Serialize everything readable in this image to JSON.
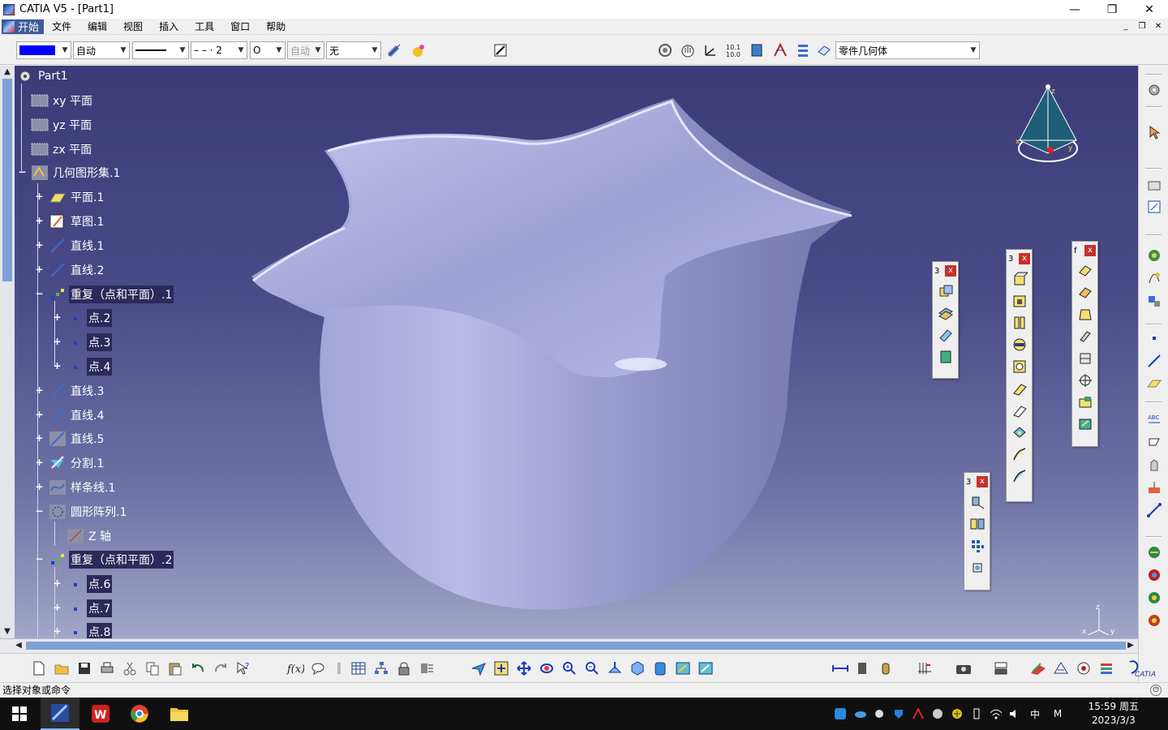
{
  "window": {
    "title": "CATIA V5 - [Part1]",
    "minimize": "—",
    "restore": "❐",
    "close": "✕"
  },
  "menu": {
    "start": "开始",
    "items": [
      "文件",
      "编辑",
      "视图",
      "插入",
      "工具",
      "窗口",
      "帮助"
    ],
    "mdi": [
      "_",
      "❐",
      "✕"
    ]
  },
  "props": {
    "color": "#0000ff",
    "transparency": "自动",
    "linetype": "————",
    "linestyle": "– – · 2",
    "point_symbol": "O",
    "layer_auto": "自动",
    "layer": "无",
    "body_select": "零件几何体"
  },
  "tree": {
    "root": "Part1",
    "nodes": [
      {
        "label": "xy 平面",
        "icon": "plane-icon"
      },
      {
        "label": "yz 平面",
        "icon": "plane-icon"
      },
      {
        "label": "zx 平面",
        "icon": "plane-icon"
      },
      {
        "label": "几何图形集.1",
        "icon": "geometrical-set-icon"
      },
      {
        "label": "平面.1",
        "icon": "plane-feature-icon"
      },
      {
        "label": "草图.1",
        "icon": "sketch-icon"
      },
      {
        "label": "直线.1",
        "icon": "line-icon"
      },
      {
        "label": "直线.2",
        "icon": "line-icon"
      },
      {
        "label": "重复（点和平面）.1",
        "icon": "repetition-icon"
      },
      {
        "label": "点.2",
        "icon": "point-icon"
      },
      {
        "label": "点.3",
        "icon": "point-icon"
      },
      {
        "label": "点.4",
        "icon": "point-icon"
      },
      {
        "label": "直线.3",
        "icon": "line-icon"
      },
      {
        "label": "直线.4",
        "icon": "line-icon"
      },
      {
        "label": "直线.5",
        "icon": "line-icon"
      },
      {
        "label": "分割.1",
        "icon": "split-icon"
      },
      {
        "label": "样条线.1",
        "icon": "spline-icon"
      },
      {
        "label": "圆形阵列.1",
        "icon": "circular-pattern-icon"
      },
      {
        "label": "Z 轴",
        "icon": "axis-icon"
      },
      {
        "label": "重复（点和平面）.2",
        "icon": "repetition-icon"
      },
      {
        "label": "点.6",
        "icon": "point-icon"
      },
      {
        "label": "点.7",
        "icon": "point-icon"
      },
      {
        "label": "点.8",
        "icon": "point-icon"
      }
    ]
  },
  "compass": {
    "x": "x",
    "y": "y",
    "z": "z"
  },
  "mini_axis": {
    "x": "x",
    "y": "y",
    "z": "z"
  },
  "floating_toolbars": [
    {
      "title": "3",
      "close": "x",
      "buttons": [
        "surface-extrude-icon",
        "surface-offset-icon",
        "surface-sweep-icon",
        "surface-fill-icon"
      ]
    },
    {
      "title": "3",
      "close": "x",
      "buttons": [
        "pad-icon",
        "pocket-icon",
        "shaft-icon",
        "groove-icon",
        "hole-icon",
        "rib-icon",
        "slot-icon",
        "stiffener-icon",
        "loft-icon",
        "remove-loft-icon"
      ]
    },
    {
      "title": "f",
      "close": "x",
      "buttons": [
        "fillet-icon",
        "chamfer-icon",
        "draft-icon",
        "shell-icon",
        "thickness-icon",
        "thread-icon",
        "remove-face-icon",
        "replace-face-icon"
      ]
    },
    {
      "title": "3",
      "close": "x",
      "buttons": [
        "translate-icon",
        "mirror-icon",
        "rect-pattern-icon",
        "scale-icon"
      ]
    }
  ],
  "statusbar": {
    "prompt": "选择对象或命令"
  },
  "taskbar": {
    "ime": "中",
    "ime2": "M",
    "time": "15:59 周五",
    "date": "2023/3/3"
  },
  "colors": {
    "accent": "#3d5b99",
    "viewport_top": "#3c3b78",
    "part": "#b7b8e6",
    "start_red": "#d33"
  }
}
